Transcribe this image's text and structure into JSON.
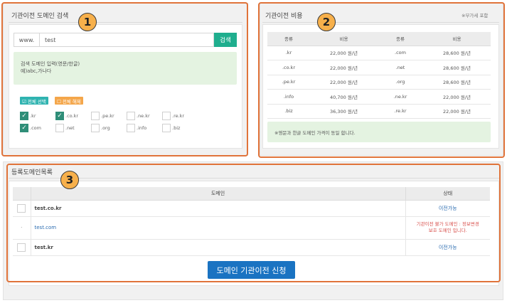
{
  "search_panel": {
    "title": "기관이전 도메인 검색",
    "badge": "1",
    "prefix": "www.",
    "input_value": "test",
    "search_button": "검색",
    "hint_line1": "검색 도메인 입력(영문/한글)",
    "hint_line2": "예)abc,가나다",
    "select_all": "☑ 전체 선택",
    "deselect_all": "☐ 전체 해제",
    "tlds": [
      {
        "label": ".kr",
        "checked": true
      },
      {
        "label": ".co.kr",
        "checked": true
      },
      {
        "label": ".pe.kr",
        "checked": false
      },
      {
        "label": ".ne.kr",
        "checked": false
      },
      {
        "label": ".re.kr",
        "checked": false
      },
      {
        "label": ".com",
        "checked": true
      },
      {
        "label": ".net",
        "checked": false
      },
      {
        "label": ".org",
        "checked": false
      },
      {
        "label": ".info",
        "checked": false
      },
      {
        "label": ".biz",
        "checked": false
      }
    ]
  },
  "cost_panel": {
    "title": "기관이전 비용",
    "badge": "2",
    "vat_note": "※부가세 포함",
    "headers": [
      "종류",
      "비용",
      "종류",
      "비용"
    ],
    "rows": [
      [
        ".kr",
        "22,000 원/년",
        ".com",
        "28,600 원/년"
      ],
      [
        ".co.kr",
        "22,000 원/년",
        ".net",
        "28,600 원/년"
      ],
      [
        ".pe.kr",
        "22,000 원/년",
        ".org",
        "28,600 원/년"
      ],
      [
        ".info",
        "40,700 원/년",
        ".ne.kr",
        "22,000 원/년"
      ],
      [
        ".biz",
        "36,300 원/년",
        ".re.kr",
        "22,000 원/년"
      ]
    ],
    "note": "※영문과 한글 도메인 가격이 동일 합니다."
  },
  "list_panel": {
    "title": "등록도메인목록",
    "badge": "3",
    "headers": [
      "도메인",
      "상태"
    ],
    "rows": [
      {
        "marker": "checkbox",
        "domain": "test.co.kr",
        "status_line1": "이전가능",
        "status_line2": ""
      },
      {
        "marker": "·",
        "domain": "test.com",
        "status_line1": "기관이전 불가 도메인 : 정보변경",
        "status_line2": "보호 도메인 입니다."
      },
      {
        "marker": "checkbox",
        "domain": "test.kr",
        "status_line1": "이전가능",
        "status_line2": ""
      }
    ],
    "apply_button": "도메인 기관이전 신청"
  }
}
